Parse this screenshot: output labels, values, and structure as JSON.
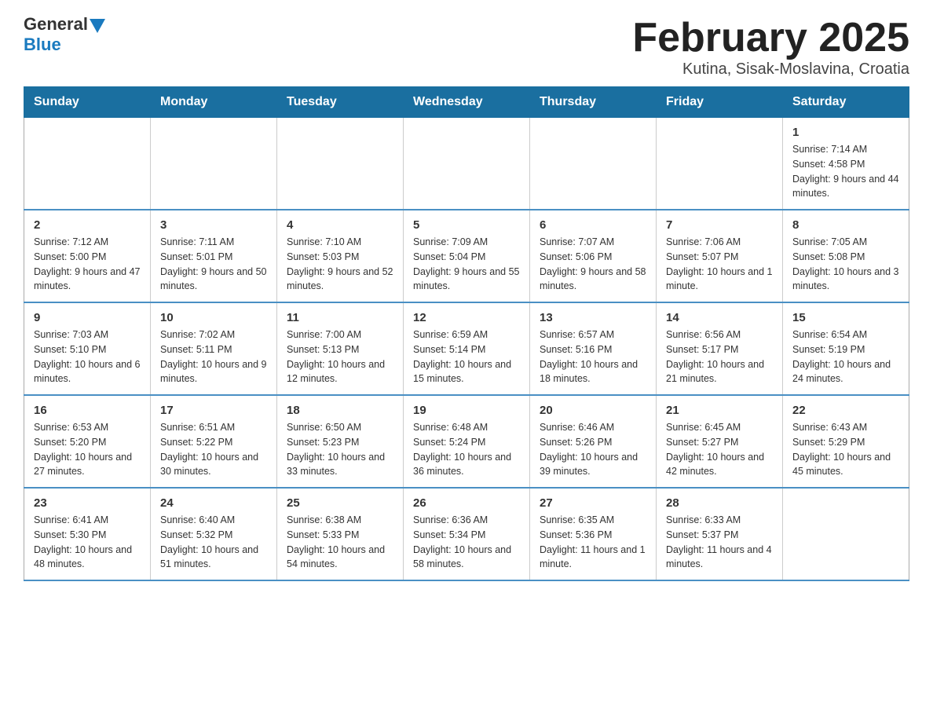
{
  "header": {
    "logo_general": "General",
    "logo_blue": "Blue",
    "title": "February 2025",
    "subtitle": "Kutina, Sisak-Moslavina, Croatia"
  },
  "days_of_week": [
    "Sunday",
    "Monday",
    "Tuesday",
    "Wednesday",
    "Thursday",
    "Friday",
    "Saturday"
  ],
  "weeks": [
    [
      {
        "day": "",
        "info": ""
      },
      {
        "day": "",
        "info": ""
      },
      {
        "day": "",
        "info": ""
      },
      {
        "day": "",
        "info": ""
      },
      {
        "day": "",
        "info": ""
      },
      {
        "day": "",
        "info": ""
      },
      {
        "day": "1",
        "info": "Sunrise: 7:14 AM\nSunset: 4:58 PM\nDaylight: 9 hours and 44 minutes."
      }
    ],
    [
      {
        "day": "2",
        "info": "Sunrise: 7:12 AM\nSunset: 5:00 PM\nDaylight: 9 hours and 47 minutes."
      },
      {
        "day": "3",
        "info": "Sunrise: 7:11 AM\nSunset: 5:01 PM\nDaylight: 9 hours and 50 minutes."
      },
      {
        "day": "4",
        "info": "Sunrise: 7:10 AM\nSunset: 5:03 PM\nDaylight: 9 hours and 52 minutes."
      },
      {
        "day": "5",
        "info": "Sunrise: 7:09 AM\nSunset: 5:04 PM\nDaylight: 9 hours and 55 minutes."
      },
      {
        "day": "6",
        "info": "Sunrise: 7:07 AM\nSunset: 5:06 PM\nDaylight: 9 hours and 58 minutes."
      },
      {
        "day": "7",
        "info": "Sunrise: 7:06 AM\nSunset: 5:07 PM\nDaylight: 10 hours and 1 minute."
      },
      {
        "day": "8",
        "info": "Sunrise: 7:05 AM\nSunset: 5:08 PM\nDaylight: 10 hours and 3 minutes."
      }
    ],
    [
      {
        "day": "9",
        "info": "Sunrise: 7:03 AM\nSunset: 5:10 PM\nDaylight: 10 hours and 6 minutes."
      },
      {
        "day": "10",
        "info": "Sunrise: 7:02 AM\nSunset: 5:11 PM\nDaylight: 10 hours and 9 minutes."
      },
      {
        "day": "11",
        "info": "Sunrise: 7:00 AM\nSunset: 5:13 PM\nDaylight: 10 hours and 12 minutes."
      },
      {
        "day": "12",
        "info": "Sunrise: 6:59 AM\nSunset: 5:14 PM\nDaylight: 10 hours and 15 minutes."
      },
      {
        "day": "13",
        "info": "Sunrise: 6:57 AM\nSunset: 5:16 PM\nDaylight: 10 hours and 18 minutes."
      },
      {
        "day": "14",
        "info": "Sunrise: 6:56 AM\nSunset: 5:17 PM\nDaylight: 10 hours and 21 minutes."
      },
      {
        "day": "15",
        "info": "Sunrise: 6:54 AM\nSunset: 5:19 PM\nDaylight: 10 hours and 24 minutes."
      }
    ],
    [
      {
        "day": "16",
        "info": "Sunrise: 6:53 AM\nSunset: 5:20 PM\nDaylight: 10 hours and 27 minutes."
      },
      {
        "day": "17",
        "info": "Sunrise: 6:51 AM\nSunset: 5:22 PM\nDaylight: 10 hours and 30 minutes."
      },
      {
        "day": "18",
        "info": "Sunrise: 6:50 AM\nSunset: 5:23 PM\nDaylight: 10 hours and 33 minutes."
      },
      {
        "day": "19",
        "info": "Sunrise: 6:48 AM\nSunset: 5:24 PM\nDaylight: 10 hours and 36 minutes."
      },
      {
        "day": "20",
        "info": "Sunrise: 6:46 AM\nSunset: 5:26 PM\nDaylight: 10 hours and 39 minutes."
      },
      {
        "day": "21",
        "info": "Sunrise: 6:45 AM\nSunset: 5:27 PM\nDaylight: 10 hours and 42 minutes."
      },
      {
        "day": "22",
        "info": "Sunrise: 6:43 AM\nSunset: 5:29 PM\nDaylight: 10 hours and 45 minutes."
      }
    ],
    [
      {
        "day": "23",
        "info": "Sunrise: 6:41 AM\nSunset: 5:30 PM\nDaylight: 10 hours and 48 minutes."
      },
      {
        "day": "24",
        "info": "Sunrise: 6:40 AM\nSunset: 5:32 PM\nDaylight: 10 hours and 51 minutes."
      },
      {
        "day": "25",
        "info": "Sunrise: 6:38 AM\nSunset: 5:33 PM\nDaylight: 10 hours and 54 minutes."
      },
      {
        "day": "26",
        "info": "Sunrise: 6:36 AM\nSunset: 5:34 PM\nDaylight: 10 hours and 58 minutes."
      },
      {
        "day": "27",
        "info": "Sunrise: 6:35 AM\nSunset: 5:36 PM\nDaylight: 11 hours and 1 minute."
      },
      {
        "day": "28",
        "info": "Sunrise: 6:33 AM\nSunset: 5:37 PM\nDaylight: 11 hours and 4 minutes."
      },
      {
        "day": "",
        "info": ""
      }
    ]
  ]
}
